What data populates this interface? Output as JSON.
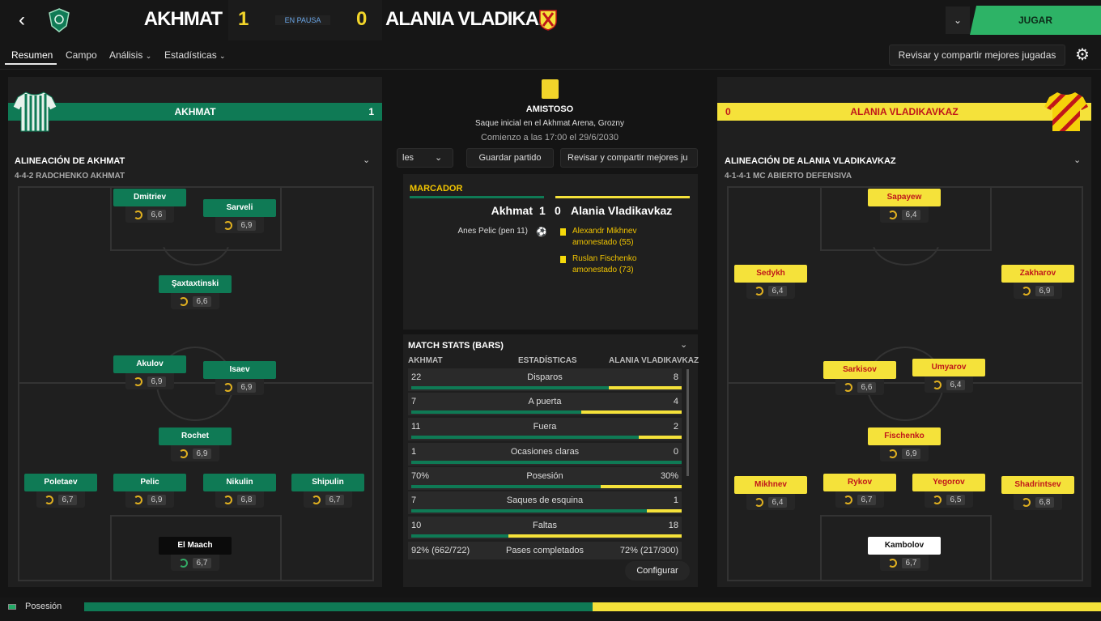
{
  "header": {
    "back_icon": "chevron-left-icon",
    "home_team": "AKHMAT",
    "away_team": "ALANIA VLADIKA...",
    "home_score": "1",
    "away_score": "0",
    "status": "EN PAUSA",
    "play_label": "JUGAR"
  },
  "nav": {
    "tabs": [
      "Resumen",
      "Campo",
      "Análisis",
      "Estadísticas"
    ],
    "share_label": "Revisar y compartir mejores jugadas"
  },
  "home_panel": {
    "bar_name": "AKHMAT",
    "bar_score": "1",
    "lineup_title": "ALINEACIÓN DE AKHMAT",
    "formation": "4-4-2 RADCHENKO AKHMAT",
    "players": [
      {
        "name": "Dmitriev",
        "rating": "6,6"
      },
      {
        "name": "Sarveli",
        "rating": "6,9"
      },
      {
        "name": "Şaxtaxtinski",
        "rating": "6,6"
      },
      {
        "name": "Akulov",
        "rating": "6,9"
      },
      {
        "name": "Isaev",
        "rating": "6,9"
      },
      {
        "name": "Rochet",
        "rating": "6,9"
      },
      {
        "name": "Poletaev",
        "rating": "6,7"
      },
      {
        "name": "Pelic",
        "rating": "6,9"
      },
      {
        "name": "Nikulin",
        "rating": "6,8"
      },
      {
        "name": "Shipulin",
        "rating": "6,7"
      },
      {
        "name": "El Maach",
        "rating": "6,7"
      }
    ]
  },
  "away_panel": {
    "bar_name": "ALANIA VLADIKAVKAZ",
    "bar_score": "0",
    "lineup_title": "ALINEACIÓN DE ALANIA VLADIKAVKAZ",
    "formation": "4-1-4-1 MC ABIERTO DEFENSIVA",
    "players": [
      {
        "name": "Sapayew",
        "rating": "6,4"
      },
      {
        "name": "Sedykh",
        "rating": "6,4"
      },
      {
        "name": "Zakharov",
        "rating": "6,9"
      },
      {
        "name": "Sarkisov",
        "rating": "6,6"
      },
      {
        "name": "Umyarov",
        "rating": "6,4"
      },
      {
        "name": "Fischenko",
        "rating": "6,9"
      },
      {
        "name": "Mikhnev",
        "rating": "6,4"
      },
      {
        "name": "Rykov",
        "rating": "6,7"
      },
      {
        "name": "Yegorov",
        "rating": "6,5"
      },
      {
        "name": "Shadrintsev",
        "rating": "6,8"
      },
      {
        "name": "Kambolov",
        "rating": "6,7"
      }
    ]
  },
  "center": {
    "competition": "AMISTOSO",
    "venue": "Saque inicial en el Akhmat Arena, Grozny",
    "kickoff": "Comienzo a las 17:00 el 29/6/2030",
    "btn_left": "les",
    "btn_save": "Guardar partido",
    "btn_share": "Revisar y compartir mejores ju",
    "marcador_title": "MARCADOR",
    "sc_home": "Akhmat",
    "sc_home_score": "1",
    "sc_away_score": "0",
    "sc_away": "Alania Vladikavkaz",
    "goal_event": "Anes Pelic (pen 11)",
    "card1_a": "Alexandr Mikhnev",
    "card1_b": "amonestado (55)",
    "card2_a": "Ruslan Fischenko",
    "card2_b": "amonestado (73)",
    "stats_title": "MATCH STATS (BARS)",
    "stats_home": "AKHMAT",
    "stats_mid": "ESTADÍSTICAS",
    "stats_away": "ALANIA VLADIKAVKAZ",
    "stats": [
      {
        "label": "Disparos",
        "home": "22",
        "away": "8",
        "hf": 0.73
      },
      {
        "label": "A puerta",
        "home": "7",
        "away": "4",
        "hf": 0.63
      },
      {
        "label": "Fuera",
        "home": "11",
        "away": "2",
        "hf": 0.84
      },
      {
        "label": "Ocasiones claras",
        "home": "1",
        "away": "0",
        "hf": 1.0
      },
      {
        "label": "Posesión",
        "home": "70%",
        "away": "30%",
        "hf": 0.7
      },
      {
        "label": "Saques de esquina",
        "home": "7",
        "away": "1",
        "hf": 0.87
      },
      {
        "label": "Faltas",
        "home": "10",
        "away": "18",
        "hf": 0.36
      },
      {
        "label": "Pases completados",
        "home": "92% (662/722)",
        "away": "72% (217/300)",
        "hf": 0.55
      }
    ],
    "configure": "Configurar"
  },
  "footer": {
    "label": "Posesión",
    "home_fraction": 0.5
  },
  "colors": {
    "home": "#0f7a55",
    "away": "#f5e23a",
    "accent": "#2db366"
  }
}
